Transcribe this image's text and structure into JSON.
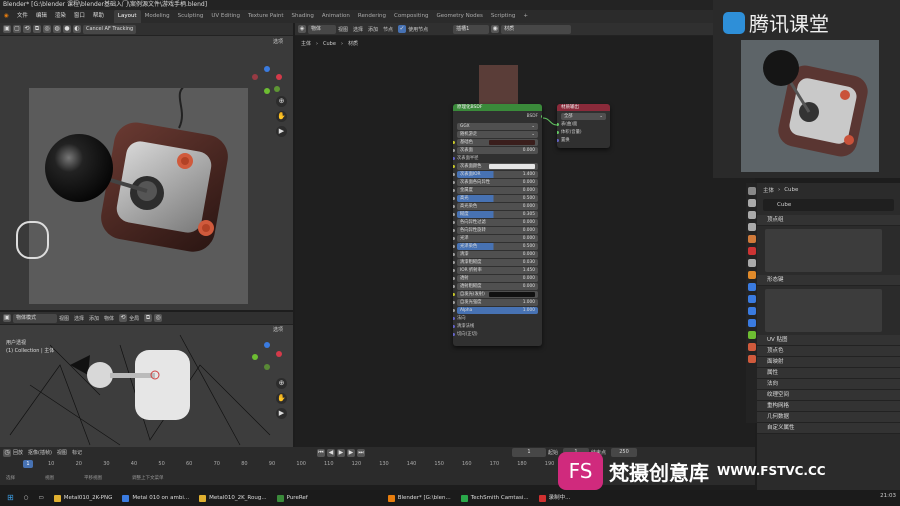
{
  "app": {
    "title": "Blender* [G:\\blender 课程\\blender基础入门\\案例源文件\\游戏手柄.blend]"
  },
  "menu": {
    "items": [
      "文件",
      "编辑",
      "渲染",
      "窗口",
      "帮助"
    ]
  },
  "workspaces": {
    "tabs": [
      "Layout",
      "Modeling",
      "Sculpting",
      "UV Editing",
      "Texture Paint",
      "Shading",
      "Animation",
      "Rendering",
      "Compositing",
      "Geometry Nodes",
      "Scripting"
    ],
    "active": "Layout"
  },
  "viewport_top": {
    "header_button": "Cancel AF Tracking",
    "options": "选项"
  },
  "viewport_bottom": {
    "mode": "物体模式",
    "menus": [
      "视图",
      "选择",
      "添加",
      "物体"
    ],
    "transform": "全局",
    "options": "选项",
    "label_view": "用户透视",
    "label_collection": "(1) Collection | 主体"
  },
  "node_editor": {
    "header": {
      "type": "物体",
      "menus": [
        "视图",
        "选择",
        "添加",
        "节点"
      ],
      "use_nodes": "使用节点",
      "slot": "插槽1",
      "material": "材质"
    },
    "breadcrumb": [
      "主体",
      "Cube",
      "材质"
    ],
    "bsdf": {
      "title": "原理化BSDF",
      "output": "BSDF",
      "distribution": "GGX",
      "subsurface_method": "随机游走",
      "rows": [
        {
          "label": "基础色",
          "value": "",
          "kind": "color-dark"
        },
        {
          "label": "次表面",
          "value": "0.000",
          "kind": "plain"
        },
        {
          "label": "次表面半径",
          "value": "",
          "kind": "text"
        },
        {
          "label": "次表面颜色",
          "value": "",
          "kind": "color-light"
        },
        {
          "label": "次表面IOR",
          "value": "1.400",
          "kind": "blue"
        },
        {
          "label": "次表面各向异性",
          "value": "0.000",
          "kind": "plain"
        },
        {
          "label": "金属度",
          "value": "0.000",
          "kind": "plain"
        },
        {
          "label": "高光",
          "value": "0.500",
          "kind": "blue"
        },
        {
          "label": "高光染色",
          "value": "0.000",
          "kind": "plain"
        },
        {
          "label": "糙度",
          "value": "0.305",
          "kind": "blue"
        },
        {
          "label": "各向异性过滤",
          "value": "0.000",
          "kind": "plain"
        },
        {
          "label": "各向异性旋转",
          "value": "0.000",
          "kind": "plain"
        },
        {
          "label": "光泽",
          "value": "0.000",
          "kind": "plain"
        },
        {
          "label": "光泽染色",
          "value": "0.500",
          "kind": "blue"
        },
        {
          "label": "清漆",
          "value": "0.000",
          "kind": "plain"
        },
        {
          "label": "清漆粗糙度",
          "value": "0.030",
          "kind": "plain"
        },
        {
          "label": "IOR 折射率",
          "value": "1.450",
          "kind": "plain"
        },
        {
          "label": "透射",
          "value": "0.000",
          "kind": "plain"
        },
        {
          "label": "透射粗糙度",
          "value": "0.000",
          "kind": "plain"
        },
        {
          "label": "自发光(发射)",
          "value": "",
          "kind": "color-black"
        },
        {
          "label": "自发光强度",
          "value": "1.000",
          "kind": "plain"
        },
        {
          "label": "Alpha",
          "value": "1.000",
          "kind": "full"
        }
      ],
      "inputs_bottom": [
        "法向",
        "清漆法线",
        "切向(正切)"
      ]
    },
    "output_node": {
      "title": "材质输出",
      "target": "全部",
      "inputs": [
        "表(曲)面",
        "体积(音量)",
        "置换"
      ]
    }
  },
  "timeline": {
    "menus": [
      "回放",
      "抠像(插帧)",
      "视图",
      "标记"
    ],
    "current_frame": "1",
    "start_label": "起始",
    "start": "1",
    "end_label": "结束点",
    "end": "250",
    "ticks": [
      "10",
      "20",
      "30",
      "40",
      "50",
      "60",
      "70",
      "80",
      "90",
      "100",
      "110",
      "120",
      "130",
      "140",
      "150",
      "160",
      "170",
      "180",
      "190"
    ],
    "current_tick": "1"
  },
  "status": {
    "items": [
      "选择",
      "视图",
      "平移视图",
      "调整上下文菜单"
    ]
  },
  "properties": {
    "breadcrumb": [
      "主体",
      "Cube"
    ],
    "mesh_name": "Cube",
    "sections_top": [
      "顶点组",
      "形态键"
    ],
    "sections": [
      "UV 贴图",
      "顶点色",
      "面映射",
      "属性",
      "法向",
      "纹理空间",
      "重构网格",
      "几何数据",
      "自定义属性"
    ]
  },
  "watermarks": {
    "top": "腾讯课堂",
    "bottom": "梵摄创意库",
    "url": "WWW.FSTVC.CC",
    "badge": "FS"
  },
  "taskbar": {
    "items": [
      "Metal010_2K-PNG",
      "Metal 010 on ambi...",
      "Metal010_2K_Roug...",
      "PureRef",
      "Blender* [G:\\blen...",
      "TechSmith Camtasi...",
      "录制中..."
    ],
    "clock": "21:03"
  },
  "colors": {
    "accent": "#4772b3",
    "bsdf_header": "#3a8a3a",
    "output_header": "#8a2a3a"
  }
}
